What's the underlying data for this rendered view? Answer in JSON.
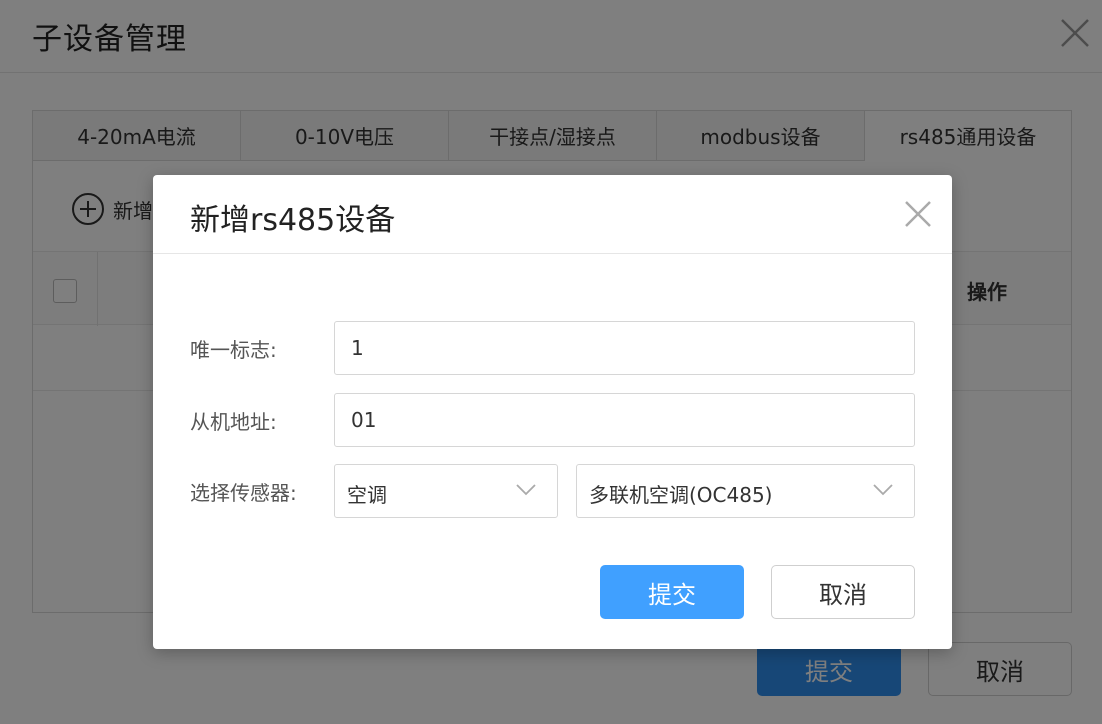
{
  "page": {
    "title": "子设备管理",
    "tabs": [
      {
        "label": "4-20mA电流"
      },
      {
        "label": "0-10V电压"
      },
      {
        "label": "干接点/湿接点"
      },
      {
        "label": "modbus设备"
      },
      {
        "label": "rs485通用设备"
      }
    ],
    "add_label": "新增",
    "table": {
      "action_header": "操作"
    },
    "submit_label": "提交",
    "cancel_label": "取消"
  },
  "modal": {
    "title": "新增rs485设备",
    "fields": {
      "unique_id": {
        "label": "唯一标志:",
        "value": "1"
      },
      "slave_address": {
        "label": "从机地址:",
        "value": "01"
      },
      "sensor": {
        "label": "选择传感器:",
        "type_value": "空调",
        "model_value": "多联机空调(OC485)"
      }
    },
    "submit_label": "提交",
    "cancel_label": "取消"
  },
  "colors": {
    "primary": "#40a0ff",
    "primary_dimmed": "#2f8fef",
    "mask": "rgba(0,0,0,0.5)"
  },
  "icons": {
    "page_close": "close-icon",
    "add": "plus-circle-icon",
    "modal_close": "close-icon",
    "select_arrow": "chevron-down-icon"
  }
}
